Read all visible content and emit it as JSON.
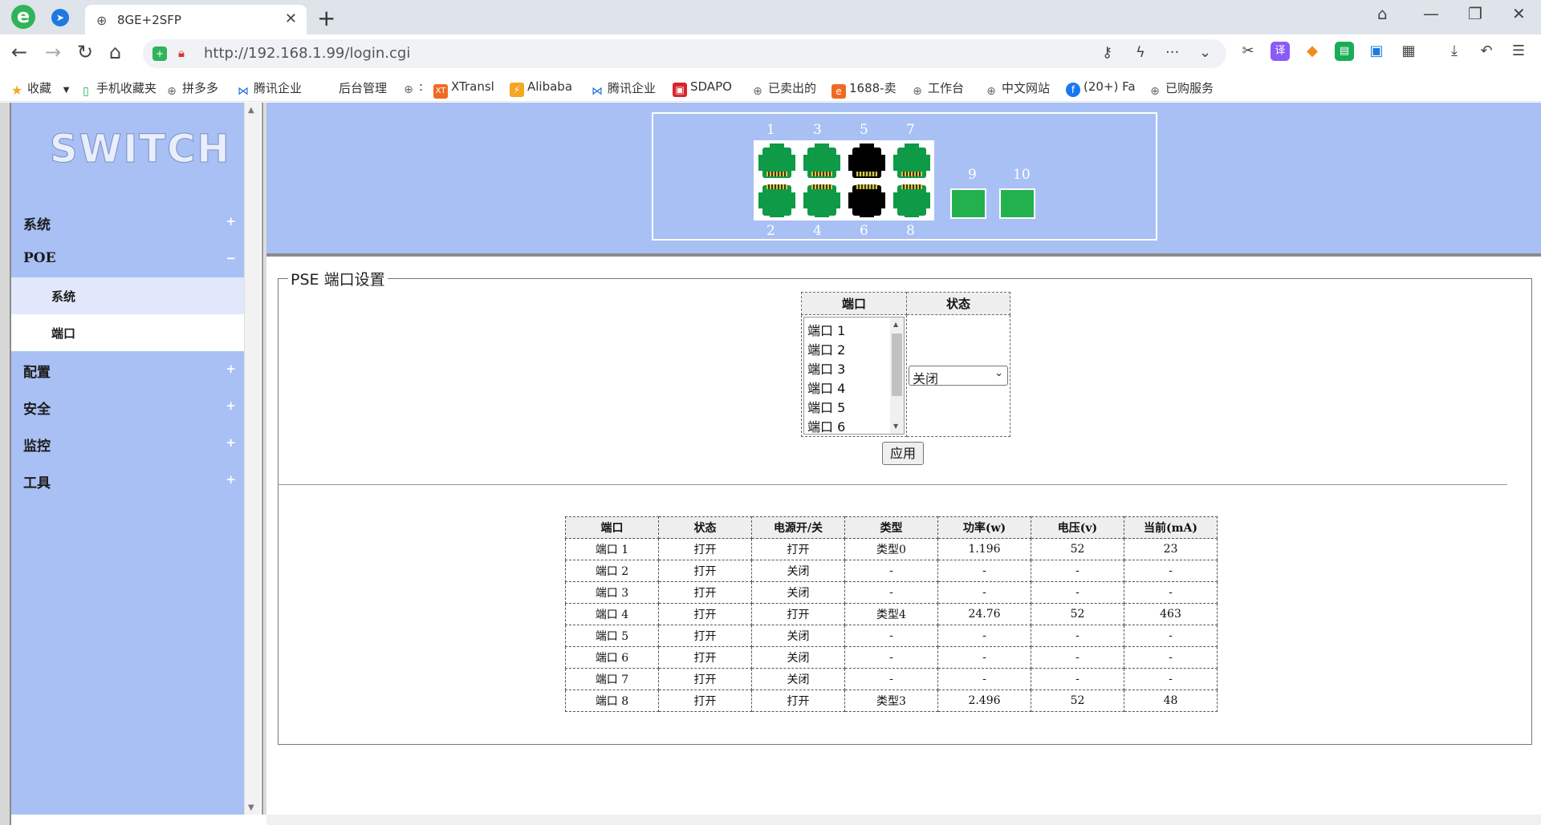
{
  "browser": {
    "tab_title": "8GE+2SFP",
    "url": "http://192.168.1.99/login.cgi",
    "bookmarks": [
      "收藏",
      "手机收藏夹",
      "拼多多",
      "腾讯企业",
      "后台管理",
      ":",
      "XTransl",
      "Alibaba",
      "腾讯企业",
      "SDAPO",
      "已卖出的",
      "1688-卖",
      "工作台",
      "中文网站",
      "(20+) Fa",
      "已购服务"
    ]
  },
  "sidebar": {
    "logo": "SWITCH",
    "menu": [
      {
        "label": "系统",
        "sign": "+"
      },
      {
        "label": "POE",
        "sign": "−"
      },
      {
        "label": "配置",
        "sign": "+"
      },
      {
        "label": "安全",
        "sign": "+"
      },
      {
        "label": "监控",
        "sign": "+"
      },
      {
        "label": "工具",
        "sign": "+"
      }
    ],
    "poe_sub": [
      {
        "label": "系统"
      },
      {
        "label": "端口"
      }
    ]
  },
  "ports_panel": {
    "top_numbers": [
      "1",
      "3",
      "5",
      "7"
    ],
    "bottom_numbers": [
      "2",
      "4",
      "6",
      "8"
    ],
    "sfp_numbers": [
      "9",
      "10"
    ],
    "colors": {
      "link_up": "#0e9a47",
      "link_down": "#000000",
      "sfp": "#23b14d"
    },
    "port_state": {
      "1": "up",
      "2": "up",
      "3": "up",
      "4": "up",
      "5": "down",
      "6": "down",
      "7": "up",
      "8": "up"
    }
  },
  "pse": {
    "legend": "PSE 端口设置",
    "header_port": "端口",
    "header_status": "状态",
    "port_list": [
      "端口 1",
      "端口 2",
      "端口 3",
      "端口 4",
      "端口 5",
      "端口 6"
    ],
    "status_value": "关闭",
    "apply_label": "应用"
  },
  "stats": {
    "headers": [
      "端口",
      "状态",
      "电源开/关",
      "类型",
      "功率(w)",
      "电压(v)",
      "当前(mA)"
    ],
    "rows": [
      [
        "端口 1",
        "打开",
        "打开",
        "类型0",
        "1.196",
        "52",
        "23"
      ],
      [
        "端口 2",
        "打开",
        "关闭",
        "-",
        "-",
        "-",
        "-"
      ],
      [
        "端口 3",
        "打开",
        "关闭",
        "-",
        "-",
        "-",
        "-"
      ],
      [
        "端口 4",
        "打开",
        "打开",
        "类型4",
        "24.76",
        "52",
        "463"
      ],
      [
        "端口 5",
        "打开",
        "关闭",
        "-",
        "-",
        "-",
        "-"
      ],
      [
        "端口 6",
        "打开",
        "关闭",
        "-",
        "-",
        "-",
        "-"
      ],
      [
        "端口 7",
        "打开",
        "关闭",
        "-",
        "-",
        "-",
        "-"
      ],
      [
        "端口 8",
        "打开",
        "打开",
        "类型3",
        "2.496",
        "52",
        "48"
      ]
    ]
  }
}
